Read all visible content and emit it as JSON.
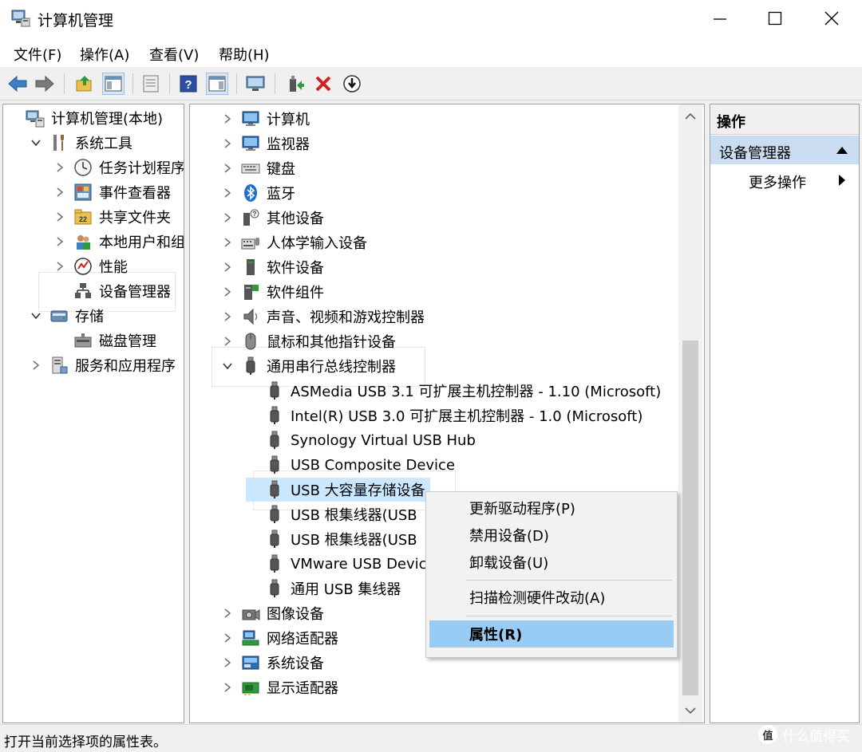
{
  "window": {
    "title": "计算机管理",
    "controls": {
      "minimize": "minimize",
      "maximize": "maximize",
      "close": "close"
    }
  },
  "menu": [
    "文件(F)",
    "操作(A)",
    "查看(V)",
    "帮助(H)"
  ],
  "toolbar": {
    "icons": [
      "back-arrow-icon",
      "forward-arrow-icon",
      "up-folder-icon",
      "show-hide-tree-icon",
      "properties-icon",
      "help-icon",
      "show-action-pane-icon",
      "computer-icon",
      "update-driver-icon",
      "uninstall-icon",
      "scan-hardware-icon"
    ]
  },
  "left_tree": {
    "items": [
      {
        "label": "计算机管理(本地)",
        "indent": 0,
        "caret": "none",
        "icon": "computer-management-icon"
      },
      {
        "label": "系统工具",
        "indent": 1,
        "caret": "down",
        "icon": "tools-icon"
      },
      {
        "label": "任务计划程序",
        "indent": 2,
        "caret": "right",
        "icon": "clock-icon"
      },
      {
        "label": "事件查看器",
        "indent": 2,
        "caret": "right",
        "icon": "event-viewer-icon"
      },
      {
        "label": "共享文件夹",
        "indent": 2,
        "caret": "right",
        "icon": "shared-folder-icon"
      },
      {
        "label": "本地用户和组",
        "indent": 2,
        "caret": "right",
        "icon": "users-icon"
      },
      {
        "label": "性能",
        "indent": 2,
        "caret": "right",
        "icon": "performance-icon"
      },
      {
        "label": "设备管理器",
        "indent": 2,
        "caret": "none",
        "icon": "device-manager-icon",
        "highlighted": true
      },
      {
        "label": "存储",
        "indent": 1,
        "caret": "down",
        "icon": "storage-icon"
      },
      {
        "label": "磁盘管理",
        "indent": 2,
        "caret": "none",
        "icon": "disk-icon"
      },
      {
        "label": "服务和应用程序",
        "indent": 1,
        "caret": "right",
        "icon": "services-icon"
      }
    ]
  },
  "device_tree": {
    "items": [
      {
        "label": "计算机",
        "indent": 0,
        "caret": "right",
        "icon": "monitor-icon"
      },
      {
        "label": "监视器",
        "indent": 0,
        "caret": "right",
        "icon": "monitor-icon"
      },
      {
        "label": "键盘",
        "indent": 0,
        "caret": "right",
        "icon": "keyboard-icon"
      },
      {
        "label": "蓝牙",
        "indent": 0,
        "caret": "right",
        "icon": "bluetooth-icon"
      },
      {
        "label": "其他设备",
        "indent": 0,
        "caret": "right",
        "icon": "unknown-device-icon"
      },
      {
        "label": "人体学输入设备",
        "indent": 0,
        "caret": "right",
        "icon": "hid-icon"
      },
      {
        "label": "软件设备",
        "indent": 0,
        "caret": "right",
        "icon": "software-device-icon"
      },
      {
        "label": "软件组件",
        "indent": 0,
        "caret": "right",
        "icon": "software-component-icon"
      },
      {
        "label": "声音、视频和游戏控制器",
        "indent": 0,
        "caret": "right",
        "icon": "speaker-icon"
      },
      {
        "label": "鼠标和其他指针设备",
        "indent": 0,
        "caret": "right",
        "icon": "mouse-icon"
      },
      {
        "label": "通用串行总线控制器",
        "indent": 0,
        "caret": "down",
        "icon": "usb-icon",
        "highlighted": true
      },
      {
        "label": "ASMedia USB 3.1 可扩展主机控制器 - 1.10 (Microsoft)",
        "indent": 1,
        "caret": "none",
        "icon": "usb-icon"
      },
      {
        "label": "Intel(R) USB 3.0 可扩展主机控制器 - 1.0 (Microsoft)",
        "indent": 1,
        "caret": "none",
        "icon": "usb-icon"
      },
      {
        "label": "Synology Virtual USB Hub",
        "indent": 1,
        "caret": "none",
        "icon": "usb-icon"
      },
      {
        "label": "USB Composite Device",
        "indent": 1,
        "caret": "none",
        "icon": "usb-icon"
      },
      {
        "label": "USB 大容量存储设备",
        "indent": 1,
        "caret": "none",
        "icon": "usb-icon",
        "selected": true
      },
      {
        "label": "USB 根集线器(USB",
        "indent": 1,
        "caret": "none",
        "icon": "usb-icon"
      },
      {
        "label": "USB 根集线器(USB",
        "indent": 1,
        "caret": "none",
        "icon": "usb-icon"
      },
      {
        "label": "VMware USB Devic",
        "indent": 1,
        "caret": "none",
        "icon": "usb-icon"
      },
      {
        "label": "通用 USB 集线器",
        "indent": 1,
        "caret": "none",
        "icon": "usb-icon"
      },
      {
        "label": "图像设备",
        "indent": 0,
        "caret": "right",
        "icon": "camera-icon"
      },
      {
        "label": "网络适配器",
        "indent": 0,
        "caret": "right",
        "icon": "network-adapter-icon"
      },
      {
        "label": "系统设备",
        "indent": 0,
        "caret": "right",
        "icon": "system-device-icon"
      },
      {
        "label": "显示适配器",
        "indent": 0,
        "caret": "right",
        "icon": "display-adapter-icon"
      }
    ]
  },
  "actions_pane": {
    "header": "操作",
    "section": "设备管理器",
    "more": "更多操作"
  },
  "context_menu": {
    "items": [
      {
        "label": "更新驱动程序(P)"
      },
      {
        "label": "禁用设备(D)"
      },
      {
        "label": "卸载设备(U)"
      },
      {
        "label": "扫描检测硬件改动(A)"
      },
      {
        "label": "属性(R)",
        "active": true
      }
    ]
  },
  "status": {
    "text": "打开当前选择项的属性表。"
  },
  "watermark": {
    "logo": "值",
    "text": "什么值得买"
  },
  "colors": {
    "selection": "#cce8ff",
    "menu_hover": "#99ccf5",
    "action_header": "#c9dcf0",
    "pane_border": "#a0a0a0"
  }
}
